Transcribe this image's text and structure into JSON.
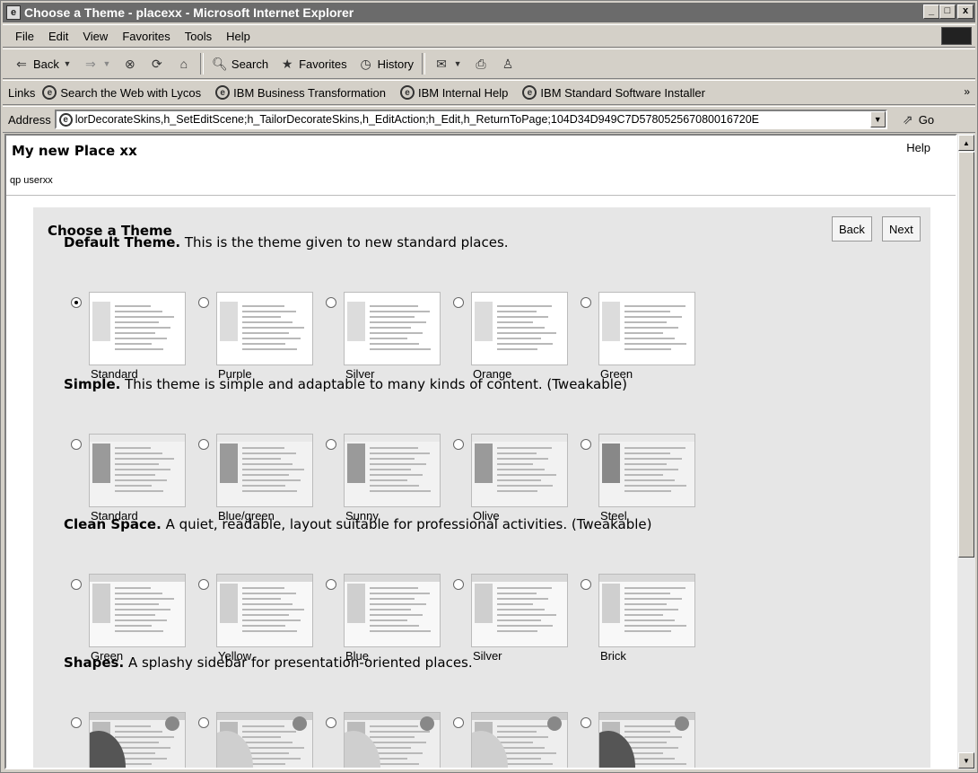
{
  "window": {
    "title": "Choose a Theme - placexx - Microsoft Internet Explorer",
    "minimize": "_",
    "maximize": "□",
    "close": "x"
  },
  "menu": [
    "File",
    "Edit",
    "View",
    "Favorites",
    "Tools",
    "Help"
  ],
  "toolbar": {
    "back": "Back",
    "search": "Search",
    "favorites": "Favorites",
    "history": "History"
  },
  "links": {
    "label": "Links",
    "items": [
      "Search the Web with Lycos",
      "IBM Business Transformation",
      "IBM Internal Help",
      "IBM Standard Software Installer"
    ]
  },
  "address": {
    "label": "Address",
    "value": "lorDecorateSkins,h_SetEditScene;h_TailorDecorateSkins,h_EditAction;h_Edit,h_ReturnToPage;104D34D949C7D578052567080016720E",
    "go": "Go"
  },
  "page": {
    "place_title": "My new Place xx",
    "help": "Help",
    "user": "qp userxx",
    "heading": "Choose a Theme",
    "back_button": "Back",
    "next_button": "Next"
  },
  "sections": [
    {
      "name": "Default Theme.",
      "description": "This is the theme given to new standard places.",
      "themes": [
        "Standard",
        "Purple",
        "Silver",
        "Orange",
        "Green"
      ]
    },
    {
      "name": "Simple.",
      "description": "This theme is simple and adaptable to many kinds of content. (Tweakable)",
      "themes": [
        "Standard",
        "Blue/green",
        "Sunny",
        "Olive",
        "Steel"
      ]
    },
    {
      "name": "Clean Space.",
      "description": "A quiet, readable, layout suitable for professional activities. (Tweakable)",
      "themes": [
        "Green",
        "Yellow",
        "Blue",
        "Silver",
        "Brick"
      ]
    },
    {
      "name": "Shapes.",
      "description": "A splashy sidebar for presentation-oriented places.",
      "themes": [
        "",
        "",
        "",
        "",
        ""
      ]
    }
  ],
  "selected_theme": "Default Theme / Standard",
  "colors": {
    "titlebar": "#6b6b6b",
    "chrome": "#d4d0c8",
    "panel": "#e6e6e6"
  }
}
